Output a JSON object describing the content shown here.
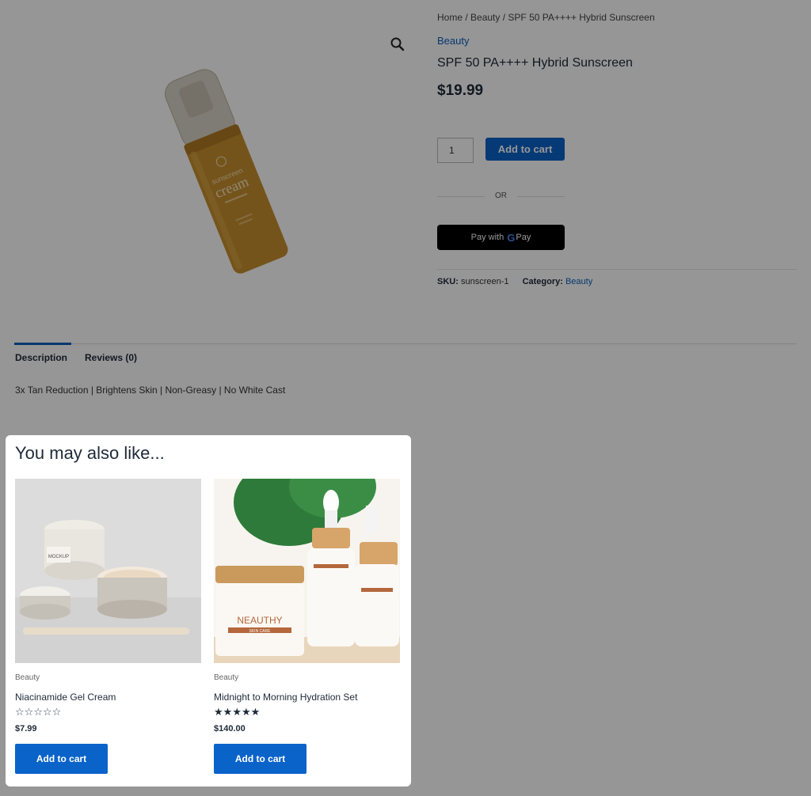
{
  "breadcrumb": {
    "home": "Home",
    "sep": " / ",
    "category": "Beauty",
    "current": "SPF 50 PA++++ Hybrid Sunscreen"
  },
  "product": {
    "category_link": "Beauty",
    "title": "SPF 50 PA++++ Hybrid Sunscreen",
    "price": "$19.99",
    "quantity": "1",
    "add_to_cart": "Add to cart",
    "or_text": "OR",
    "gpay_label": "Pay with",
    "gpay_g": "G",
    "gpay_pay": "Pay",
    "sku_label": "SKU:",
    "sku_value": "sunscreen-1",
    "category_label": "Category:",
    "category_value": "Beauty",
    "image_text": {
      "line1": "sunscreen",
      "line2": "cream"
    }
  },
  "tabs": [
    {
      "label": "Description",
      "active": true
    },
    {
      "label": "Reviews (0)",
      "active": false
    }
  ],
  "description": "3x Tan Reduction | Brightens Skin | Non-Greasy | No White Cast",
  "related": {
    "heading": "You may also like...",
    "products": [
      {
        "category": "Beauty",
        "name": "Niacinamide Gel Cream",
        "rating": 0,
        "max_rating": 5,
        "price": "$7.99",
        "button": "Add to cart",
        "image_label": "MOCKUP"
      },
      {
        "category": "Beauty",
        "name": "Midnight to Morning Hydration Set",
        "rating": 5,
        "max_rating": 5,
        "price": "$140.00",
        "button": "Add to cart",
        "image_label": "NEAUTHY",
        "image_sublabel": "SKIN CARE"
      }
    ]
  },
  "colors": {
    "accent": "#0a63c9",
    "link": "#0a5fbf",
    "overlay": "rgba(0,0,0,0.41)",
    "text": "#1e2a38"
  },
  "icons": {
    "zoom": "search-icon",
    "star_full": "star-filled-icon",
    "star_empty": "star-outline-icon"
  }
}
